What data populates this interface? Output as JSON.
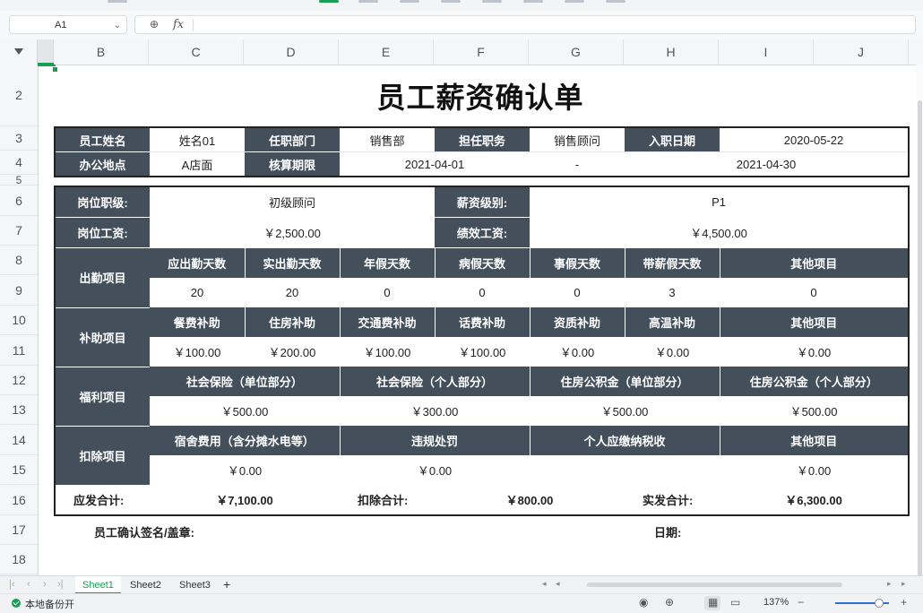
{
  "formula_bar": {
    "cell_ref": "A1",
    "fx": "fx",
    "formula": ""
  },
  "columns": [
    "B",
    "C",
    "D",
    "E",
    "F",
    "G",
    "H",
    "I",
    "J"
  ],
  "rows": [
    "2",
    "3",
    "4",
    "5",
    "6",
    "7",
    "8",
    "9",
    "10",
    "11",
    "12",
    "13",
    "14",
    "15",
    "16",
    "17",
    "18"
  ],
  "title": "员工薪资确认单",
  "info": {
    "employee_name_label": "员工姓名",
    "employee_name": "姓名01",
    "department_label": "任职部门",
    "department": "销售部",
    "position_label": "担任职务",
    "position": "销售顾问",
    "hire_date_label": "入职日期",
    "hire_date": "2020-05-22",
    "office_label": "办公地点",
    "office": "A店面",
    "period_label": "核算期限",
    "period_start": "2021-04-01",
    "period_sep": "-",
    "period_end": "2021-04-30"
  },
  "salary": {
    "grade_label": "岗位职级:",
    "grade": "初级顾问",
    "level_label": "薪资级别:",
    "level": "P1",
    "base_label": "岗位工资:",
    "base": "￥2,500.00",
    "perf_label": "绩效工资:",
    "perf": "￥4,500.00"
  },
  "attendance": {
    "section": "出勤项目",
    "headers": [
      "应出勤天数",
      "实出勤天数",
      "年假天数",
      "病假天数",
      "事假天数",
      "带薪假天数",
      "其他项目"
    ],
    "values": [
      "20",
      "20",
      "0",
      "0",
      "0",
      "3",
      "0"
    ]
  },
  "subsidy": {
    "section": "补助项目",
    "headers": [
      "餐费补助",
      "住房补助",
      "交通费补助",
      "话费补助",
      "资质补助",
      "高温补助",
      "其他项目"
    ],
    "values": [
      "￥100.00",
      "￥200.00",
      "￥100.00",
      "￥100.00",
      "￥0.00",
      "￥0.00",
      "￥0.00"
    ]
  },
  "welfare": {
    "section": "福利项目",
    "headers": [
      "社会保险（单位部分）",
      "社会保险（个人部分）",
      "住房公积金（单位部分）",
      "住房公积金（个人部分）"
    ],
    "values": [
      "￥500.00",
      "￥300.00",
      "￥500.00",
      "￥500.00"
    ]
  },
  "deduction": {
    "section": "扣除项目",
    "headers": [
      "宿舍费用（含分摊水电等）",
      "违规处罚",
      "个人应缴纳税收",
      "其他项目"
    ],
    "values": [
      "￥0.00",
      "￥0.00",
      "",
      "￥0.00"
    ]
  },
  "totals": {
    "gross_label": "应发合计:",
    "gross": "￥7,100.00",
    "deduct_label": "扣除合计:",
    "deduct": "￥800.00",
    "net_label": "实发合计:",
    "net": "￥6,300.00"
  },
  "footer": {
    "signature_label": "员工确认签名/盖章:",
    "date_label": "日期:"
  },
  "sheet_tabs": [
    "Sheet1",
    "Sheet2",
    "Sheet3"
  ],
  "status": {
    "backup": "本地备份开",
    "zoom": "137%"
  }
}
